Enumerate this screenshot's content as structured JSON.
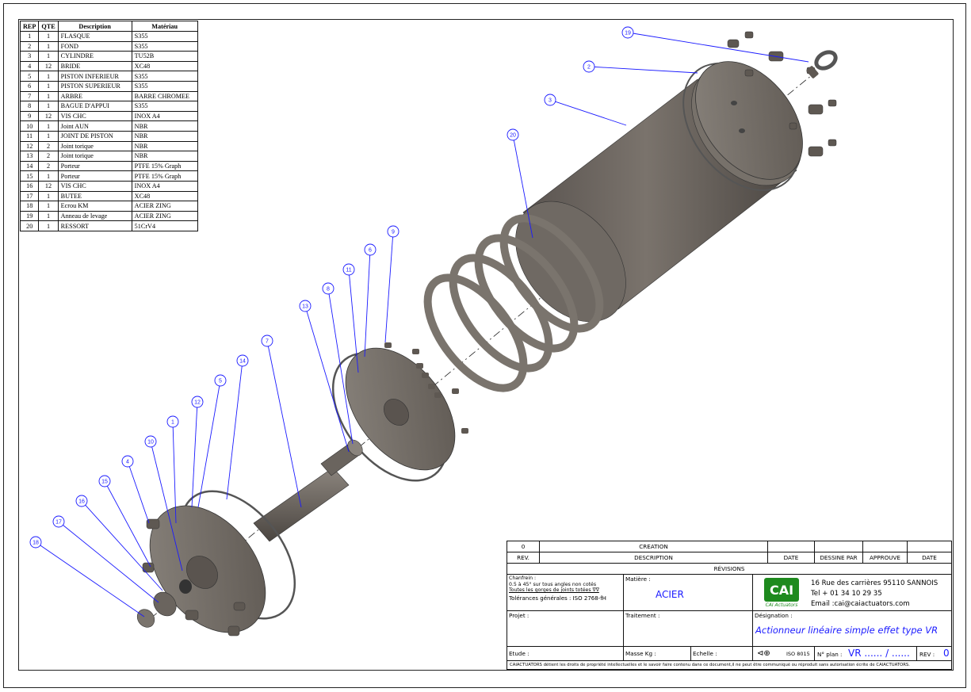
{
  "bom": {
    "headers": [
      "REP",
      "QTE",
      "Description",
      "Matériau"
    ],
    "rows": [
      [
        "1",
        "1",
        "FLASQUE",
        "S355"
      ],
      [
        "2",
        "1",
        "FOND",
        "S355"
      ],
      [
        "3",
        "1",
        "CYLINDRE",
        "TU52B"
      ],
      [
        "4",
        "12",
        "BRIDE",
        "XC48"
      ],
      [
        "5",
        "1",
        "PISTON INFERIEUR",
        "S355"
      ],
      [
        "6",
        "1",
        "PISTON SUPERIEUR",
        "S355"
      ],
      [
        "7",
        "1",
        "ARBRE",
        "BARRE CHROMEE"
      ],
      [
        "8",
        "1",
        "BAGUE D'APPUI",
        "S355"
      ],
      [
        "9",
        "12",
        "VIS CHC",
        "INOX A4"
      ],
      [
        "10",
        "1",
        "Joint AUN",
        "NBR"
      ],
      [
        "11",
        "1",
        "JOINT DE PISTON",
        "NBR"
      ],
      [
        "12",
        "2",
        "Joint torique",
        "NBR"
      ],
      [
        "13",
        "2",
        "Joint torique",
        "NBR"
      ],
      [
        "14",
        "2",
        "Porteur",
        "PTFE 15% Graph"
      ],
      [
        "15",
        "1",
        "Porteur",
        "PTFE 15% Graph"
      ],
      [
        "16",
        "12",
        "VIS CHC",
        "INOX A4"
      ],
      [
        "17",
        "1",
        "BUTEE",
        "XC48"
      ],
      [
        "18",
        "1",
        "Ecrou KM",
        "ACIER ZING"
      ],
      [
        "19",
        "1",
        "Anneau de levage",
        "ACIER ZING"
      ],
      [
        "20",
        "1",
        "RESSORT",
        "51CrV4"
      ]
    ]
  },
  "balloons": [
    "19",
    "2",
    "3",
    "20",
    "9",
    "6",
    "11",
    "8",
    "13",
    "7",
    "14",
    "5",
    "12",
    "1",
    "10",
    "4",
    "15",
    "16",
    "17",
    "18"
  ],
  "title_block": {
    "rev_row": {
      "rev": "0",
      "description": "CREATION",
      "date": "",
      "dessine_par": "",
      "approuve": "",
      "date2": ""
    },
    "rev_header": {
      "rev": "REV.",
      "description": "DESCRIPTION",
      "date": "DATE",
      "dessine_par": "DESSINE PAR",
      "approuve": "APPROUVE",
      "date2": "DATE"
    },
    "revisions_label": "RÉVISIONS",
    "chanfrein_line1": "Chanfrein :",
    "chanfrein_line2": "0.5 à 45° sur tous angles non cotés",
    "chanfrein_line3": "Toutes les gorges de joints totées ∇∇",
    "tolerances": "Tolérances générales : ISO 2768-fH",
    "matiere_label": "Matière :",
    "matiere_value": "ACIER",
    "logo_text": "CAI",
    "logo_caption": "CAI Actuators",
    "address": "16 Rue des carrières 95110 SANNOIS",
    "tel": "Tel + 01 34 10 29 35",
    "email": "Email :cai@caiactuators.com",
    "projet_label": "Projet :",
    "traitement_label": "Traitement :",
    "designation_label": "Désignation :",
    "designation_value": "Actionneur linéaire simple effet type VR",
    "etude_label": "Etude :",
    "masse_label": "Masse Kg :",
    "echelle_label": "Echelle :",
    "iso_label": "ISO 8015",
    "nplan_label": "N° plan :",
    "nplan_value": "VR ...... / ......",
    "rev_label": "REV :",
    "rev_value": "0",
    "footer": "CAIACTUATORS détient les droits de propriété intellectuelles et le savoir faire contenu dans ce document,il ne peut être communiqué ou réproduit sans autorisation écrite de CAIACTUATORS."
  },
  "colors": {
    "balloon": "#1a1aff",
    "logo_green": "#1e8a1e",
    "metal": "#6e6862"
  }
}
